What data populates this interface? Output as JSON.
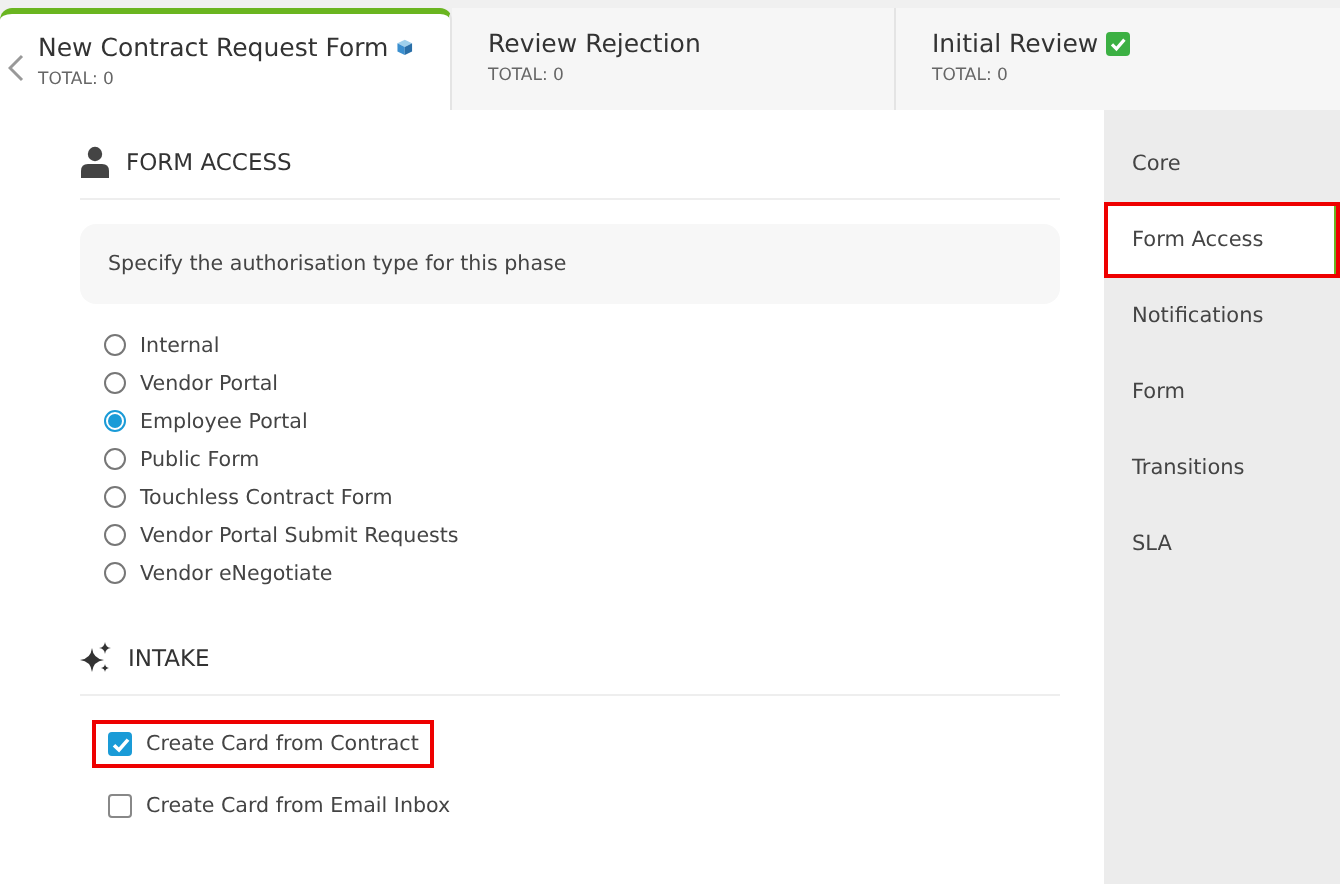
{
  "tabs": [
    {
      "title": "New Contract Request Form",
      "kind": "cube",
      "total": "TOTAL: 0",
      "selected": true
    },
    {
      "title": "Review Rejection",
      "total": "TOTAL: 0",
      "selected": false
    },
    {
      "title": "Initial Review",
      "kind": "check",
      "total": "TOTAL: 0",
      "selected": false
    }
  ],
  "form_access": {
    "heading": "FORM ACCESS",
    "hint": "Specify the authorisation type for this phase",
    "options": [
      {
        "label": "Internal",
        "selected": false
      },
      {
        "label": "Vendor Portal",
        "selected": false
      },
      {
        "label": "Employee Portal",
        "selected": true
      },
      {
        "label": "Public Form",
        "selected": false
      },
      {
        "label": "Touchless Contract Form",
        "selected": false
      },
      {
        "label": "Vendor Portal Submit Requests",
        "selected": false
      },
      {
        "label": "Vendor eNegotiate",
        "selected": false
      }
    ]
  },
  "intake": {
    "heading": "INTAKE",
    "options": [
      {
        "label": "Create Card from Contract",
        "checked": true,
        "highlighted": true
      },
      {
        "label": "Create Card from Email Inbox",
        "checked": false,
        "highlighted": false
      }
    ]
  },
  "sidebar": {
    "items": [
      {
        "label": "Core",
        "selected": false,
        "highlighted": false
      },
      {
        "label": "Form Access",
        "selected": true,
        "highlighted": true
      },
      {
        "label": "Notifications",
        "selected": false,
        "highlighted": false
      },
      {
        "label": "Form",
        "selected": false,
        "highlighted": false
      },
      {
        "label": "Transitions",
        "selected": false,
        "highlighted": false
      },
      {
        "label": "SLA",
        "selected": false,
        "highlighted": false
      }
    ]
  }
}
